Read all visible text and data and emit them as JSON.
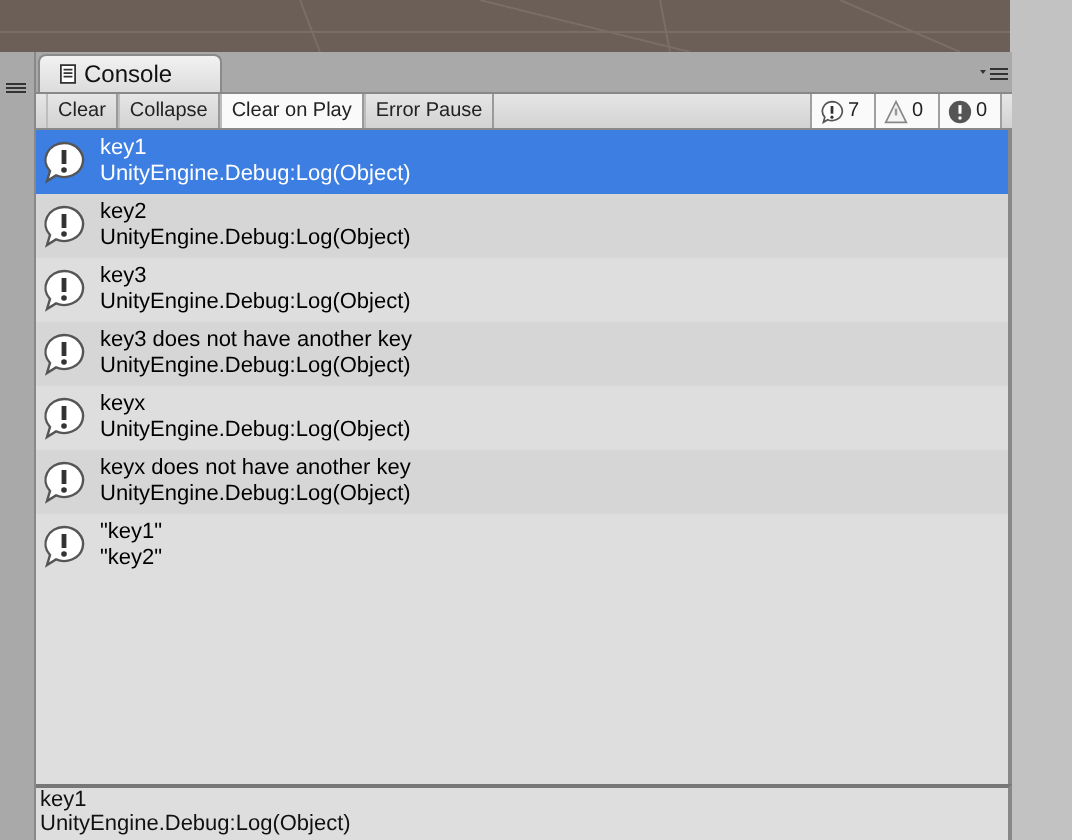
{
  "tab": {
    "title": "Console"
  },
  "toolbar": [
    {
      "label": "Clear",
      "kind": "button"
    },
    {
      "label": "Collapse",
      "kind": "toggle",
      "selected": false
    },
    {
      "label": "Clear on Play",
      "kind": "toggle",
      "selected": true
    },
    {
      "label": "Error Pause",
      "kind": "toggle",
      "selected": false
    }
  ],
  "counters": [
    {
      "kind": "info",
      "count": "7"
    },
    {
      "kind": "warning",
      "count": "0"
    },
    {
      "kind": "error",
      "count": "0"
    }
  ],
  "entries": [
    {
      "message": "key1",
      "trace": "UnityEngine.Debug:Log(Object)",
      "selected": true
    },
    {
      "message": "key2",
      "trace": "UnityEngine.Debug:Log(Object)",
      "selected": false
    },
    {
      "message": "key3",
      "trace": "UnityEngine.Debug:Log(Object)",
      "selected": false
    },
    {
      "message": "key3 does not have another key",
      "trace": "UnityEngine.Debug:Log(Object)",
      "selected": false
    },
    {
      "message": "keyx",
      "trace": "UnityEngine.Debug:Log(Object)",
      "selected": false
    },
    {
      "message": "keyx does not have another key",
      "trace": "UnityEngine.Debug:Log(Object)",
      "selected": false
    },
    {
      "message": "\"key1\"",
      "trace": "\"key2\"",
      "selected": false
    }
  ],
  "detail": {
    "message": "key1",
    "trace": "UnityEngine.Debug:Log(Object)"
  }
}
